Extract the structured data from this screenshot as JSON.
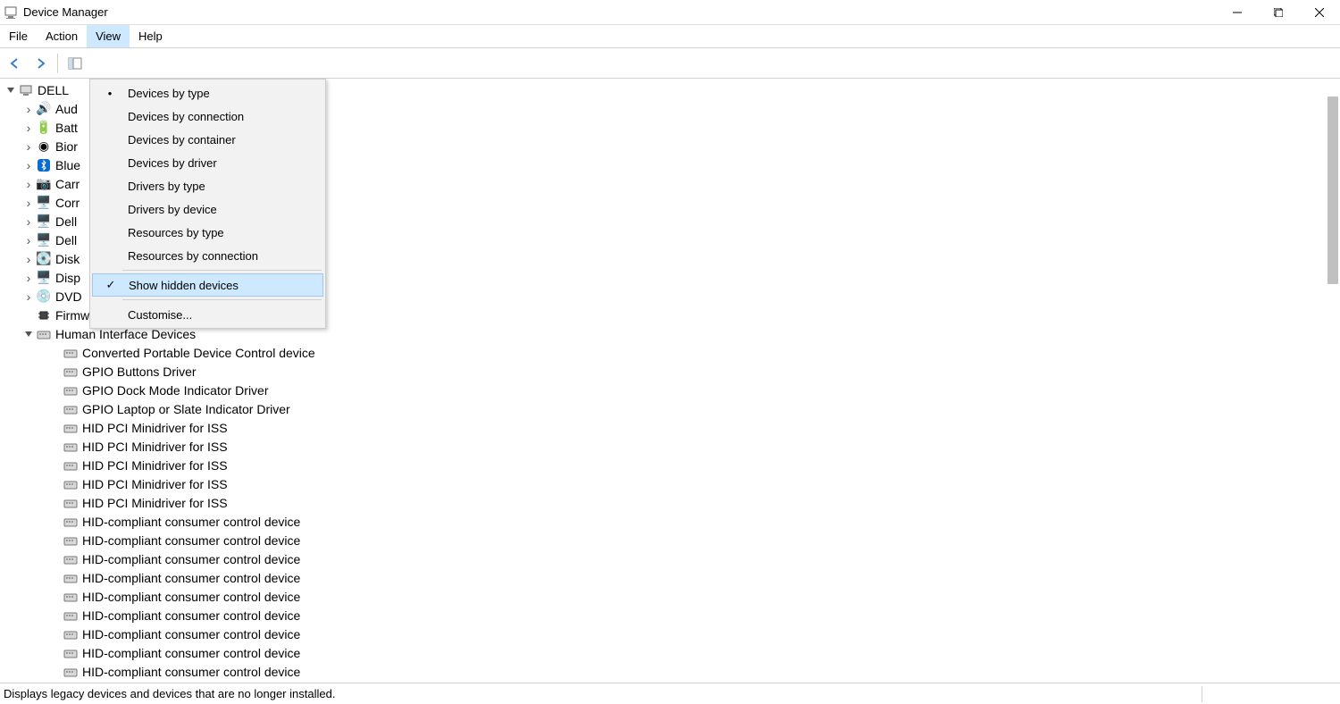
{
  "window": {
    "title": "Device Manager"
  },
  "menubar": {
    "file": "File",
    "action": "Action",
    "view": "View",
    "help": "Help"
  },
  "view_menu": {
    "devices_by_type": "Devices by type",
    "devices_by_connection": "Devices by connection",
    "devices_by_container": "Devices by container",
    "devices_by_driver": "Devices by driver",
    "drivers_by_type": "Drivers by type",
    "drivers_by_device": "Drivers by device",
    "resources_by_type": "Resources by type",
    "resources_by_connection": "Resources by connection",
    "show_hidden": "Show hidden devices",
    "customise": "Customise..."
  },
  "tree": {
    "root": "DELL",
    "cat": {
      "audio": "Aud",
      "battery": "Batt",
      "biometric": "Bior",
      "bluetooth": "Blue",
      "cameras": "Carr",
      "computer": "Corr",
      "dell1": "Dell",
      "dell2": "Dell",
      "disk": "Disk",
      "display": "Disp",
      "dvd": "DVD",
      "firmware": "Firmware",
      "hid": "Human Interface Devices"
    },
    "hid_children": [
      "Converted Portable Device Control device",
      "GPIO Buttons Driver",
      "GPIO Dock Mode Indicator Driver",
      "GPIO Laptop or Slate Indicator Driver",
      "HID PCI Minidriver for ISS",
      "HID PCI Minidriver for ISS",
      "HID PCI Minidriver for ISS",
      "HID PCI Minidriver for ISS",
      "HID PCI Minidriver for ISS",
      "HID-compliant consumer control device",
      "HID-compliant consumer control device",
      "HID-compliant consumer control device",
      "HID-compliant consumer control device",
      "HID-compliant consumer control device",
      "HID-compliant consumer control device",
      "HID-compliant consumer control device",
      "HID-compliant consumer control device",
      "HID-compliant consumer control device"
    ]
  },
  "statusbar": {
    "text": "Displays legacy devices and devices that are no longer installed."
  }
}
